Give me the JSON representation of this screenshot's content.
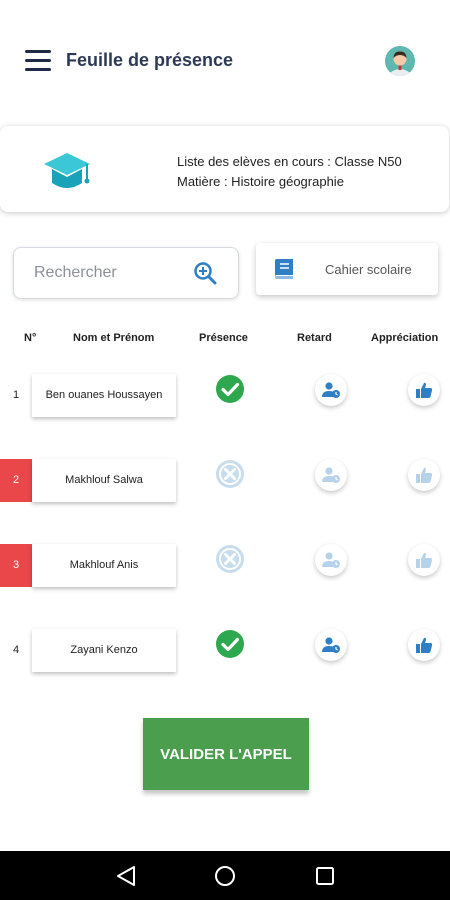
{
  "header": {
    "title": "Feuille de présence",
    "menu_icon": "hamburger-menu-icon",
    "avatar_icon": "user-avatar-icon"
  },
  "info": {
    "icon": "graduation-cap-icon",
    "line1": "Liste des elèves en cours : Classe N50",
    "line2": "Matière : Histoire géographie"
  },
  "search": {
    "placeholder": "Rechercher",
    "icon": "search-plus-icon"
  },
  "cahier": {
    "label": "Cahier scolaire",
    "icon": "book-icon"
  },
  "table": {
    "headers": {
      "num": "N°",
      "name": "Nom et Prénom",
      "presence": "Présence",
      "retard": "Retard",
      "appreciation": "Appréciation"
    },
    "rows": [
      {
        "num": "1",
        "name": "Ben ouanes Houssayen",
        "present": true
      },
      {
        "num": "2",
        "name": "Makhlouf Salwa",
        "present": false
      },
      {
        "num": "3",
        "name": "Makhlouf Anis",
        "present": false
      },
      {
        "num": "4",
        "name": "Zayani Kenzo",
        "present": true
      }
    ]
  },
  "validate": {
    "label": "VALIDER L'APPEL"
  },
  "colors": {
    "present_green": "#2ea84f",
    "absent_red": "#e9474a",
    "icon_blue": "#2f7fc6",
    "validate_green": "#4a9e4d"
  },
  "navbar": {
    "back_icon": "back-triangle-icon",
    "home_icon": "home-circle-icon",
    "recents_icon": "recents-square-icon"
  }
}
